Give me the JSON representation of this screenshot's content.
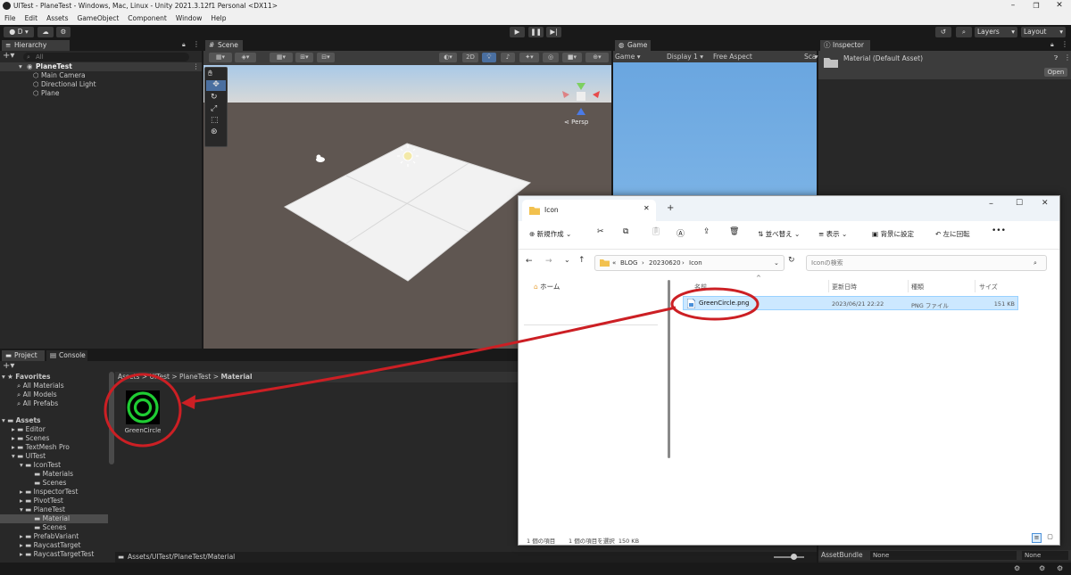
{
  "window": {
    "title": "UITest - PlaneTest - Windows, Mac, Linux - Unity 2021.3.12f1 Personal <DX11>",
    "menu": [
      "File",
      "Edit",
      "Assets",
      "GameObject",
      "Component",
      "Window",
      "Help"
    ]
  },
  "toolbar": {
    "account_label": "D",
    "layers_label": "Layers",
    "layout_label": "Layout"
  },
  "hierarchy": {
    "tab_label": "Hierarchy",
    "search_placeholder": "All",
    "scene_name": "PlaneTest",
    "items": [
      "Main Camera",
      "Directional Light",
      "Plane"
    ]
  },
  "scene": {
    "tab_label": "Scene",
    "mode_2d": "2D",
    "persp_label": "Persp"
  },
  "game": {
    "tab_label": "Game",
    "view_label": "Game",
    "display_label": "Display 1",
    "aspect_label": "Free Aspect",
    "scale_label": "Sca"
  },
  "inspector": {
    "tab_label": "Inspector",
    "asset_title": "Material (Default Asset)",
    "open_button": "Open",
    "assetbundle_label": "AssetBundle",
    "assetbundle_value": "None",
    "variant_value": "None"
  },
  "project": {
    "tab_project": "Project",
    "tab_console": "Console",
    "favorites_label": "Favorites",
    "favorites": [
      "All Materials",
      "All Models",
      "All Prefabs"
    ],
    "assets_label": "Assets",
    "tree": [
      {
        "label": "Editor",
        "depth": 1
      },
      {
        "label": "Scenes",
        "depth": 1
      },
      {
        "label": "TextMesh Pro",
        "depth": 1
      },
      {
        "label": "UITest",
        "depth": 1
      },
      {
        "label": "IconTest",
        "depth": 2
      },
      {
        "label": "Materials",
        "depth": 3
      },
      {
        "label": "Scenes",
        "depth": 3
      },
      {
        "label": "InspectorTest",
        "depth": 2
      },
      {
        "label": "PivotTest",
        "depth": 2
      },
      {
        "label": "PlaneTest",
        "depth": 2
      },
      {
        "label": "Material",
        "depth": 3
      },
      {
        "label": "Scenes",
        "depth": 3
      },
      {
        "label": "PrefabVariant",
        "depth": 2
      },
      {
        "label": "RaycastTarget",
        "depth": 2
      },
      {
        "label": "RaycastTargetTest",
        "depth": 2
      }
    ],
    "breadcrumb": [
      "Assets",
      "UITest",
      "PlaneTest",
      "Material"
    ],
    "asset_name": "GreenCircle",
    "path": "Assets/UITest/PlaneTest/Material"
  },
  "explorer": {
    "tab_title": "Icon",
    "new_label": "新規作成",
    "sort_label": "並べ替え",
    "view_label": "表示",
    "wallpaper_label": "背景に設定",
    "rotate_label": "左に回転",
    "breadcrumb": [
      "BLOG",
      "20230620",
      "Icon"
    ],
    "search_placeholder": "Iconの検索",
    "home_label": "ホーム",
    "columns": [
      "名前",
      "更新日時",
      "種類",
      "サイズ"
    ],
    "file": {
      "name": "GreenCircle.png",
      "date": "2023/06/21 22:22",
      "type": "PNG ファイル",
      "size": "151 KB"
    },
    "status_count": "1 個の項目",
    "status_selected": "1 個の項目を選択  150 KB"
  },
  "colors": {
    "annotation": "#cc1f24",
    "unity_panel": "#282828",
    "selection": "#2c5d87",
    "green_circle": "#1fcc33"
  }
}
